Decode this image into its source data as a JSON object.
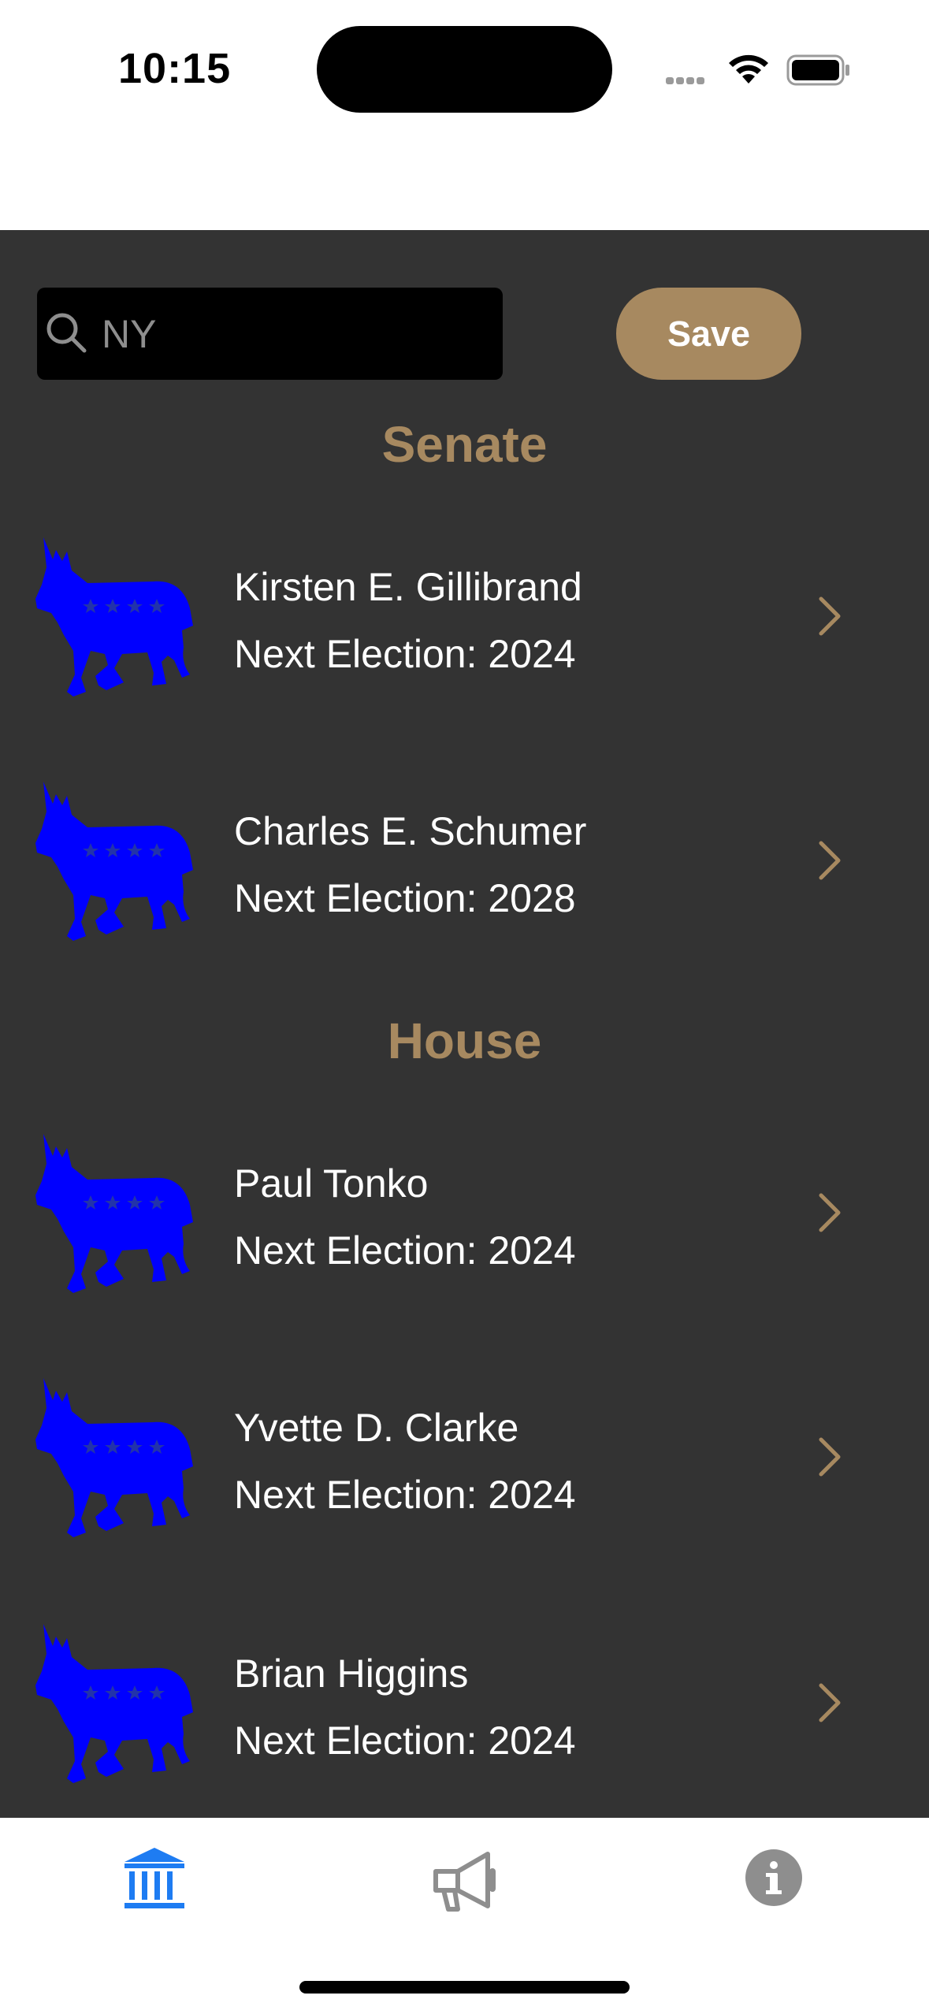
{
  "status_bar": {
    "time": "10:15"
  },
  "search": {
    "value": "NY",
    "placeholder": "Search"
  },
  "toolbar": {
    "save_label": "Save"
  },
  "sections": {
    "senate": {
      "title": "Senate",
      "members": [
        {
          "name": "Kirsten E. Gillibrand",
          "election": "Next Election: 2024",
          "party_icon": "democrat-donkey-icon"
        },
        {
          "name": "Charles E. Schumer",
          "election": "Next Election: 2028",
          "party_icon": "democrat-donkey-icon"
        }
      ]
    },
    "house": {
      "title": "House",
      "members": [
        {
          "name": "Paul Tonko",
          "election": "Next Election: 2024",
          "party_icon": "democrat-donkey-icon"
        },
        {
          "name": "Yvette D. Clarke",
          "election": "Next Election: 2024",
          "party_icon": "democrat-donkey-icon"
        },
        {
          "name": "Brian Higgins",
          "election": "Next Election: 2024",
          "party_icon": "democrat-donkey-icon"
        }
      ]
    }
  },
  "tab_bar": {
    "tabs": [
      {
        "icon": "capitol-building-icon",
        "selected": true
      },
      {
        "icon": "megaphone-icon",
        "selected": false
      },
      {
        "icon": "info-icon",
        "selected": false
      }
    ]
  },
  "colors": {
    "accent": "#A78960",
    "background": "#333333",
    "party_blue": "#0000FF",
    "tab_selected": "#1E7CF2",
    "tab_unselected": "#8E8E8E"
  }
}
